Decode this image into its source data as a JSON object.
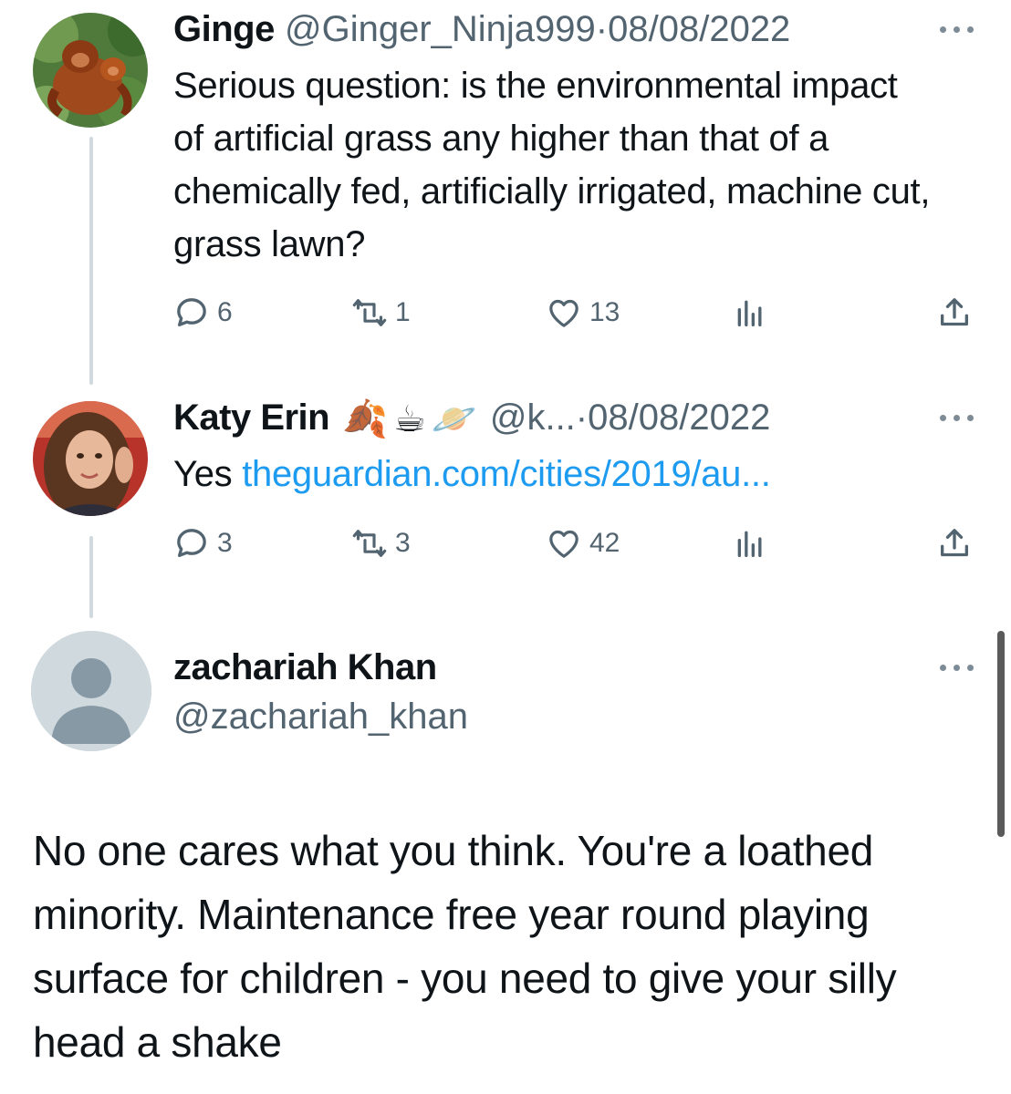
{
  "tweets": [
    {
      "display_name": "Ginge",
      "handle": "@Ginger_Ninja999",
      "separator": "·",
      "date": "08/08/2022",
      "text": "Serious question: is the environmental impact of artificial grass any higher than that of a chemically fed, artificially irrigated, machine cut, grass lawn?",
      "actions": {
        "replies": "6",
        "retweets": "1",
        "likes": "13"
      }
    },
    {
      "display_name": "Katy Erin",
      "name_emojis": [
        "🍂",
        "☕",
        "🪐"
      ],
      "handle": "@k...",
      "separator": "·",
      "date": "08/08/2022",
      "text_prefix": "Yes",
      "link_text": "theguardian.com/cities/2019/au...",
      "actions": {
        "replies": "3",
        "retweets": "3",
        "likes": "42"
      }
    }
  ],
  "reply": {
    "display_name": "zachariah Khan",
    "handle": "@zachariah_khan",
    "text": "No one cares what you think. You're a loathed minority. Maintenance free year round playing surface for children - you need to give your silly head a shake"
  },
  "icons": {
    "reply": "speech-bubble-icon",
    "retweet": "retweet-icon",
    "like": "heart-icon",
    "views": "bar-chart-icon",
    "share": "share-icon",
    "more": "more-dots-icon"
  },
  "colors": {
    "text": "#0f1419",
    "secondary": "#536471",
    "link": "#1d9bf0",
    "thread_line": "#cfd9de",
    "placeholder_avatar_bg": "#cfd9de",
    "placeholder_avatar_fg": "#8899a6"
  }
}
